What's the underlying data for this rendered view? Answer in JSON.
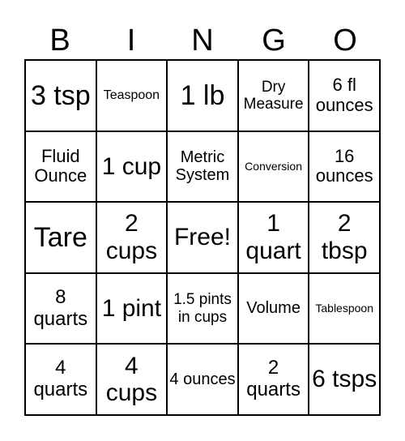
{
  "header": [
    "B",
    "I",
    "N",
    "G",
    "O"
  ],
  "cells": [
    [
      "3 tsp",
      "Teaspoon",
      "1 lb",
      "Dry Measure",
      "6 fl ounces"
    ],
    [
      "Fluid Ounce",
      "1 cup",
      "Metric System",
      "Conversion",
      "16 ounces"
    ],
    [
      "Tare",
      "2 cups",
      "Free!",
      "1 quart",
      "2 tbsp"
    ],
    [
      "8 quarts",
      "1 pint",
      "1.5 pints in cups",
      "Volume",
      "Tablespoon"
    ],
    [
      "4 quarts",
      "4 cups",
      "4 ounces",
      "2 quarts",
      "6 tsps"
    ]
  ]
}
